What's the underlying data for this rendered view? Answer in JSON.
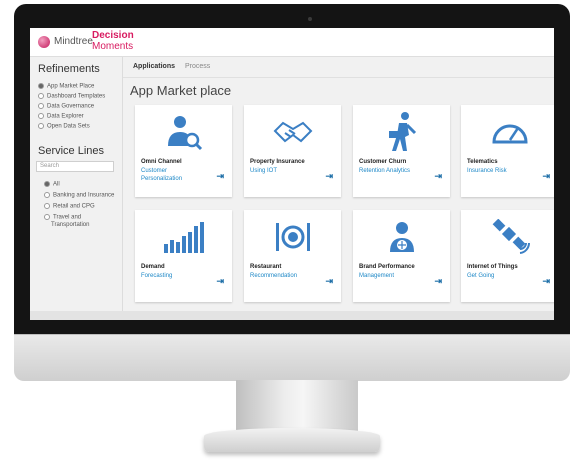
{
  "logo": {
    "brand": "Mindtree",
    "product_line1": "Decision",
    "product_line2": "Moments"
  },
  "sidebar": {
    "refinements_title": "Refinements",
    "refinements": [
      {
        "label": "App Market Place",
        "selected": true
      },
      {
        "label": "Dashboard Templates",
        "selected": false
      },
      {
        "label": "Data Governance",
        "selected": false
      },
      {
        "label": "Data Explorer",
        "selected": false
      },
      {
        "label": "Open Data Sets",
        "selected": false
      }
    ],
    "service_lines_title": "Service Lines",
    "search_placeholder": "Search",
    "service_lines": [
      {
        "label": "All",
        "selected": true
      },
      {
        "label": "Banking and Insurance",
        "selected": false
      },
      {
        "label": "Retail and CPG",
        "selected": false
      },
      {
        "label": "Travel and",
        "line2": "Transportation",
        "selected": false
      }
    ]
  },
  "tabs": [
    {
      "label": "Applications",
      "active": true
    },
    {
      "label": "Process",
      "active": false
    }
  ],
  "page_title": "App Market place",
  "cards": [
    {
      "title": "Omni Channel",
      "subtitle": "Customer Personalization",
      "icon": "person-search-icon"
    },
    {
      "title": "Property Insurance",
      "subtitle": "Using IOT",
      "icon": "handshake-icon"
    },
    {
      "title": "Customer Churn",
      "subtitle": "Retention Analytics",
      "icon": "walking-person-icon"
    },
    {
      "title": "Telematics",
      "subtitle": "Insurance Risk",
      "icon": "speedometer-icon"
    },
    {
      "title": "Demand",
      "subtitle": "Forecasting",
      "icon": "bar-chart-icon"
    },
    {
      "title": "Restaurant",
      "subtitle": "Recommendation",
      "icon": "plate-cutlery-icon"
    },
    {
      "title": "Brand Performance",
      "subtitle": "Management",
      "icon": "person-globe-icon"
    },
    {
      "title": "Internet of Things",
      "subtitle": "Get Going",
      "icon": "satellite-icon"
    }
  ],
  "colors": {
    "accent": "#1e88c7",
    "brand": "#d81b60",
    "icon_blue": "#3b7fc4"
  }
}
